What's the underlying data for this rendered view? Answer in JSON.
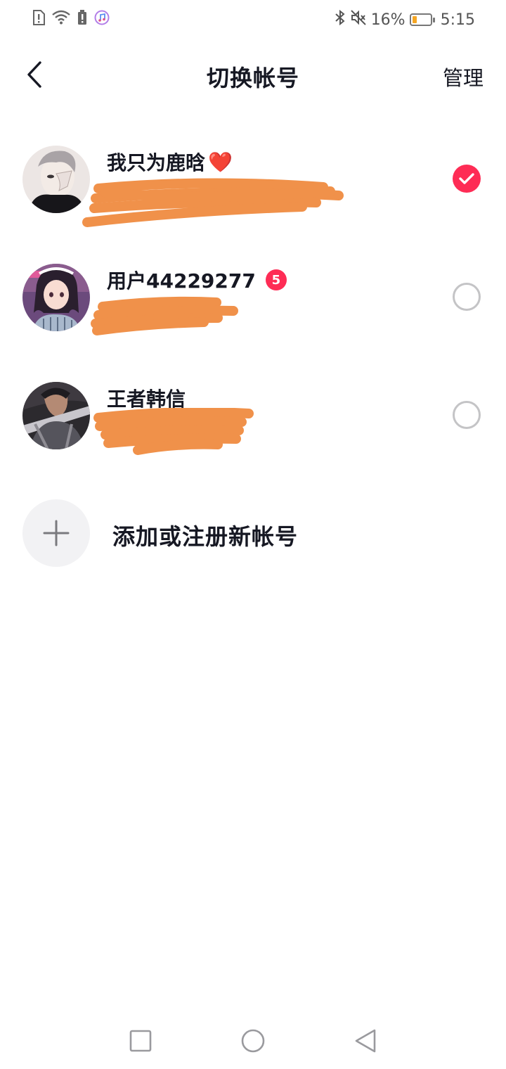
{
  "status_bar": {
    "battery_percent": "16%",
    "battery_level": 0.16,
    "time": "5:15",
    "accent_battery_color": "#f5a623",
    "icons": [
      "sim-alert-icon",
      "wifi-icon",
      "battery-alert-icon",
      "music-icon",
      "bluetooth-icon",
      "mute-icon",
      "battery-icon"
    ]
  },
  "header": {
    "back_icon": "chevron-left-icon",
    "title": "切换帐号",
    "manage_label": "管理"
  },
  "accounts": [
    {
      "name": "我只为鹿晗",
      "emoji": "❤️",
      "badge": "",
      "selected": true
    },
    {
      "name": "用户44229277",
      "emoji": "",
      "badge": "5",
      "selected": false
    },
    {
      "name": "王者韩信",
      "emoji": "",
      "badge": "",
      "selected": false
    }
  ],
  "add_account": {
    "icon": "plus-icon",
    "label": "添加或注册新帐号"
  },
  "colors": {
    "accent": "#fe2c55",
    "redaction": "#f0914a",
    "text": "#161823"
  },
  "nav_bar": {
    "icons": [
      "recents-square-icon",
      "home-circle-icon",
      "back-triangle-icon"
    ]
  }
}
